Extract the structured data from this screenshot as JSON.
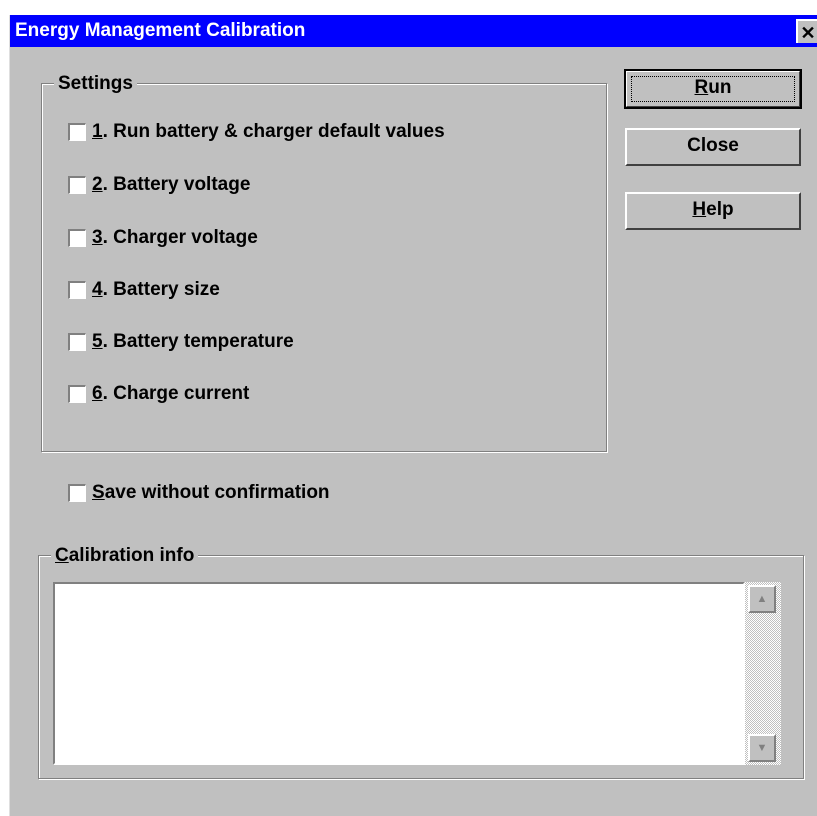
{
  "window": {
    "title": "Energy Management Calibration",
    "close_glyph": "✕"
  },
  "settings": {
    "legend": "Settings",
    "items": [
      {
        "num": "1",
        "label": ". Run battery & charger default values",
        "checked": false
      },
      {
        "num": "2",
        "label": ". Battery voltage",
        "checked": false
      },
      {
        "num": "3",
        "label": ". Charger voltage",
        "checked": false
      },
      {
        "num": "4",
        "label": ". Battery size",
        "checked": false
      },
      {
        "num": "5",
        "label": ". Battery temperature",
        "checked": false
      },
      {
        "num": "6",
        "label": ". Charge current",
        "checked": false
      }
    ]
  },
  "save_option": {
    "mnemonic": "S",
    "rest": "ave without confirmation",
    "checked": false
  },
  "buttons": {
    "run": {
      "mnemonic": "R",
      "rest": "un"
    },
    "close": {
      "label": "Close"
    },
    "help": {
      "mnemonic": "H",
      "rest": "elp"
    }
  },
  "calibration": {
    "legend_mnemonic": "C",
    "legend_rest": "alibration info",
    "text": ""
  },
  "icons": {
    "scroll_up": "up-arrow-icon",
    "scroll_down": "down-arrow-icon"
  },
  "colors": {
    "titlebar": "#0000ff",
    "face": "#c0c0c0"
  }
}
